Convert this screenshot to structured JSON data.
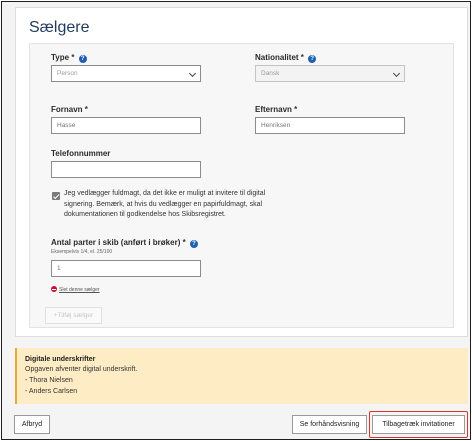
{
  "section_title": "Sælgere",
  "type_field": {
    "label": "Type",
    "required": "*",
    "value": "Person"
  },
  "nationality_field": {
    "label": "Nationalitet",
    "required": "*",
    "value": "Dansk"
  },
  "firstname_field": {
    "label": "Fornavn",
    "required": "*",
    "value": "Hasse"
  },
  "lastname_field": {
    "label": "Efternavn",
    "required": "*",
    "value": "Henriksen"
  },
  "phone_field": {
    "label": "Telefonnummer",
    "value": ""
  },
  "power_of_attorney": {
    "checked": true,
    "line1": "Jeg vedlægger fuldmagt, da det ikke er muligt at invitere til digital",
    "line2": "signering. Bemærk, at hvis du vedlægger en papirfuldmagt, skal",
    "line3": "dokumentationen til godkendelse hos Skibsregistret."
  },
  "shares_field": {
    "label": "Antal parter i skib (anført i brøker)",
    "required": "*",
    "hint": "Eksempelvis 1/4, el. 25/100",
    "value": "1"
  },
  "delete_seller_label": "Slet denne sælger",
  "add_seller_label": "+Tilføj sælger",
  "signatures_notice": {
    "title": "Digitale underskrifter",
    "message": "Opgaven afventer digital underskrift.",
    "signers": [
      "- Thora Nielsen",
      "- Anders Carlsen"
    ]
  },
  "footer": {
    "cancel_label": "Afbryd",
    "preview_label": "Se forhåndsvisning",
    "withdraw_label": "Tilbagetræk invitationer"
  },
  "colors": {
    "title": "#1f3a5f",
    "notice_bg": "#fdecc4",
    "notice_border": "#e8a93b",
    "highlight": "#d9342b",
    "info_icon": "#1f5fb4"
  }
}
